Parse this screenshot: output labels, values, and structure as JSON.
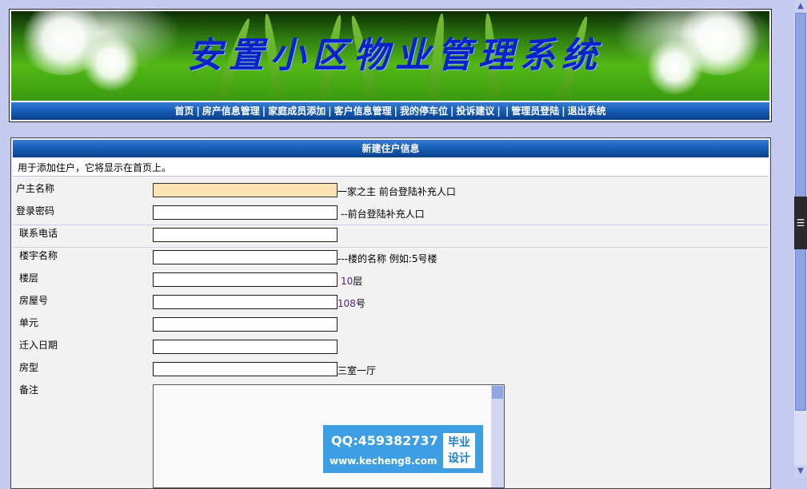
{
  "banner": {
    "title": "安置小区物业管理系统"
  },
  "nav": {
    "items": [
      "首页",
      "房产信息管理",
      "家庭成员添加",
      "客户信息管理",
      "我的停车位",
      "投诉建议",
      "",
      "管理员登陆",
      "退出系统"
    ]
  },
  "form": {
    "heading": "新建住户信息",
    "description": "用于添加住户，它将显示在首页上。",
    "fields": [
      {
        "label": "户主名称",
        "value": "",
        "hint": "一家之主 前台登陆补充人口"
      },
      {
        "label": "登录密码",
        "value": "",
        "hint": "--前台登陆补充人口"
      },
      {
        "label": "联系电话",
        "value": "",
        "hint": ""
      },
      {
        "label": "楼宇名称",
        "value": "",
        "hint": "---楼的名称 例如:5号楼"
      },
      {
        "label": "楼层",
        "value": "",
        "hint_num": "10",
        "hint": "层"
      },
      {
        "label": "房屋号",
        "value": "",
        "hint_num": "108",
        "hint": "号"
      },
      {
        "label": "单元",
        "value": "",
        "hint": ""
      },
      {
        "label": "迁入日期",
        "value": "",
        "hint": ""
      },
      {
        "label": "房型",
        "value": "",
        "hint": "三室一厅"
      },
      {
        "label": "备注",
        "value": ""
      }
    ]
  },
  "watermark": {
    "qq": "QQ:459382737",
    "url": "www.kecheng8.com",
    "badge_line1": "毕业",
    "badge_line2": "设计"
  },
  "side_tab": {
    "icon": "list-icon"
  },
  "colors": {
    "page_bg": "#c4cbee",
    "nav_blue": "#145cb6",
    "title_blue": "#0a22c8",
    "focus_bg": "#fde3b3"
  }
}
